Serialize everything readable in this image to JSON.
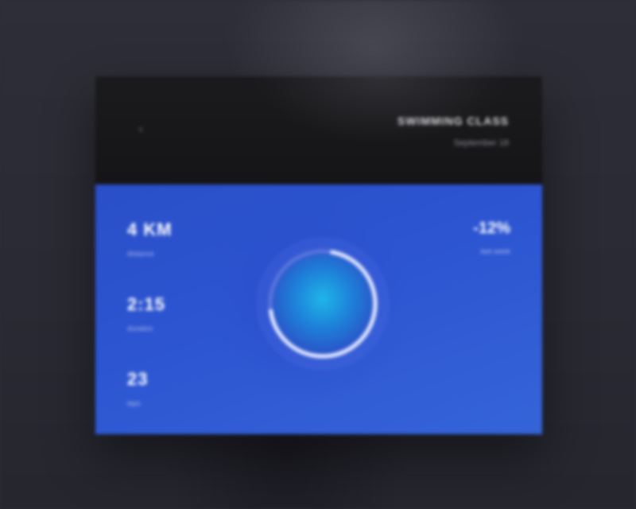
{
  "header": {
    "title": "SWIMMING CLASS",
    "subtitle": "September 18"
  },
  "stats": [
    {
      "value": "4 KM",
      "label": "distance"
    },
    {
      "value": "2:15",
      "label": "duration"
    },
    {
      "value": "23",
      "label": "laps"
    }
  ],
  "change": {
    "value": "-12%",
    "label": "last week"
  },
  "progress": {
    "fraction": 0.7
  },
  "icons": {
    "back": "back-arrow-icon"
  },
  "colors": {
    "accent": "#2d55d2",
    "header_bg": "#18181a",
    "ring_color": "#e8eeff"
  }
}
